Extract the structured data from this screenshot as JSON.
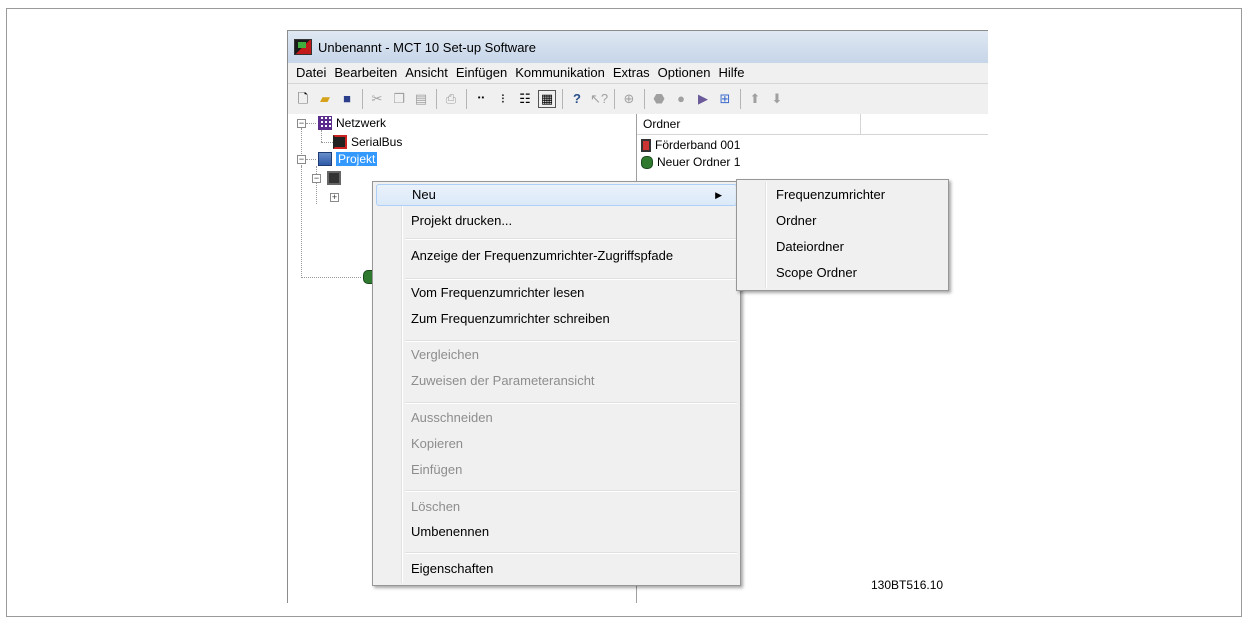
{
  "window": {
    "title": "Unbenannt - MCT 10 Set-up Software"
  },
  "menubar": {
    "items": [
      "Datei",
      "Bearbeiten",
      "Ansicht",
      "Einfügen",
      "Kommunikation",
      "Extras",
      "Optionen",
      "Hilfe"
    ]
  },
  "toolbar": {
    "icons": [
      "new-file-icon",
      "open-folder-icon",
      "save-icon",
      "cut-icon",
      "copy-icon",
      "paste-icon",
      "print-icon",
      "small-icons-view-icon",
      "list-view-icon",
      "details-view-icon",
      "grid-view-icon",
      "help-icon",
      "context-help-icon",
      "network-scan-icon",
      "stop-icon",
      "record-icon",
      "drive-connect-icon",
      "drive-settings-icon",
      "arrow-up-icon",
      "arrow-down-icon"
    ]
  },
  "tree": {
    "network_label": "Netzwerk",
    "serialbus_label": "SerialBus",
    "project_label": "Projekt"
  },
  "list": {
    "column_header": "Ordner",
    "items": [
      "Förderband 001",
      "Neuer Ordner 1"
    ]
  },
  "context_menu": {
    "items": [
      {
        "label": "Neu"
      },
      {
        "label": "Projekt drucken..."
      },
      {
        "label": "Anzeige der Frequenzumrichter-Zugriffspfade"
      },
      {
        "label": "Vom Frequenzumrichter lesen"
      },
      {
        "label": "Zum Frequenzumrichter schreiben"
      },
      {
        "label": "Vergleichen"
      },
      {
        "label": "Zuweisen der Parameteransicht"
      },
      {
        "label": "Ausschneiden"
      },
      {
        "label": "Kopieren"
      },
      {
        "label": "Einfügen"
      },
      {
        "label": "Löschen"
      },
      {
        "label": "Umbenennen"
      },
      {
        "label": "Eigenschaften"
      }
    ]
  },
  "submenu": {
    "items": [
      "Frequenzumrichter",
      "Ordner",
      "Dateiordner",
      "Scope Ordner"
    ]
  },
  "figure_id": "130BT516.10"
}
